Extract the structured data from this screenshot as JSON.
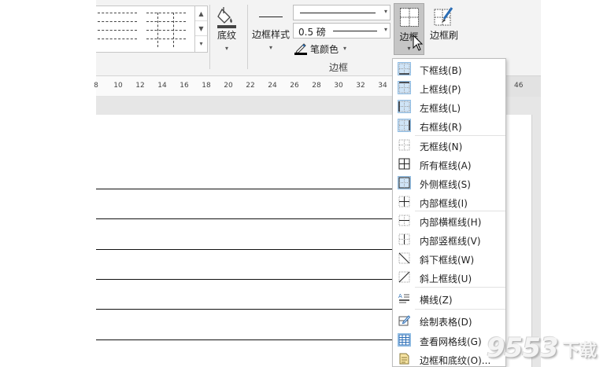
{
  "ribbon": {
    "shading_label": "底纹",
    "border_styles_label": "边框样式",
    "pen_weight_value": "0.5 磅",
    "pen_color_label": "笔颜色",
    "borders_label": "边框",
    "border_painter_label": "边框刷",
    "group_label": "边框",
    "icons": {
      "shading": "paint-bucket-icon",
      "borders": "all-borders-icon",
      "painter": "border-painter-brush-icon",
      "pen_color": "pencil-icon"
    }
  },
  "ruler": {
    "ticks": [
      "8",
      "10",
      "12",
      "14",
      "16",
      "18",
      "20",
      "22",
      "24",
      "26",
      "28",
      "30",
      "32",
      "34"
    ],
    "end_label": "46"
  },
  "menu": {
    "items": [
      {
        "label": "下框线(B)",
        "icon": "bottom-border-icon",
        "checked": true
      },
      {
        "label": "上框线(P)",
        "icon": "top-border-icon",
        "checked": true
      },
      {
        "label": "左框线(L)",
        "icon": "left-border-icon",
        "checked": true
      },
      {
        "label": "右框线(R)",
        "icon": "right-border-icon",
        "checked": true
      },
      {
        "label": "无框线(N)",
        "icon": "no-border-icon",
        "checked": false
      },
      {
        "label": "所有框线(A)",
        "icon": "all-borders-icon",
        "checked": false
      },
      {
        "label": "外侧框线(S)",
        "icon": "outside-borders-icon",
        "checked": true
      },
      {
        "label": "内部框线(I)",
        "icon": "inside-borders-icon",
        "checked": false
      },
      {
        "label": "内部横框线(H)",
        "icon": "inside-horizontal-border-icon",
        "checked": false
      },
      {
        "label": "内部竖框线(V)",
        "icon": "inside-vertical-border-icon",
        "checked": false
      },
      {
        "label": "斜下框线(W)",
        "icon": "diagonal-down-border-icon",
        "checked": false
      },
      {
        "label": "斜上框线(U)",
        "icon": "diagonal-up-border-icon",
        "checked": false
      },
      {
        "label": "横线(Z)",
        "icon": "horizontal-line-icon",
        "checked": false
      },
      {
        "label": "绘制表格(D)",
        "icon": "draw-table-icon",
        "checked": false
      },
      {
        "label": "查看网格线(G)",
        "icon": "view-gridlines-icon",
        "checked": true
      },
      {
        "label": "边框和底纹(O)...",
        "icon": "borders-and-shading-icon",
        "checked": false
      }
    ]
  },
  "watermark": {
    "number": "9553",
    "text": "下载"
  }
}
